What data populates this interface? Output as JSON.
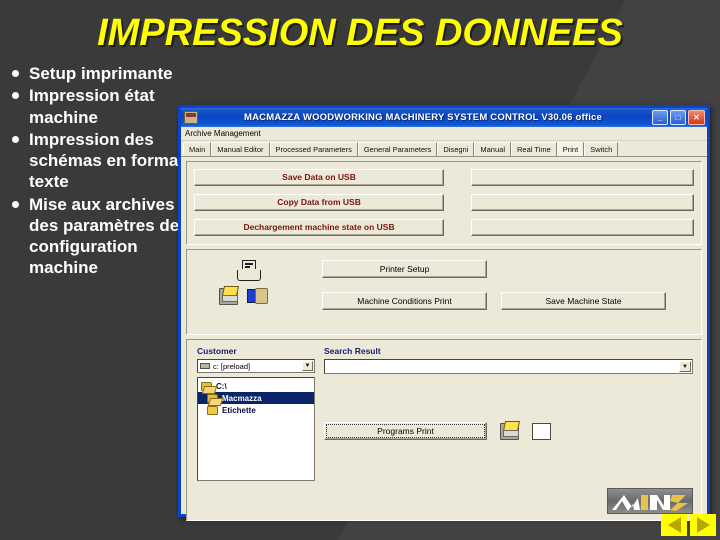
{
  "slide": {
    "title": "IMPRESSION DES DONNEES",
    "bullets": [
      "Setup imprimante",
      "Impression état machine",
      "Impression des schémas en format texte",
      "Mise aux archives des paramètres de configuration machine"
    ]
  },
  "app": {
    "title": "MACMAZZA WOODWORKING MACHINERY SYSTEM CONTROL  V30.06 office",
    "window_buttons": {
      "minimize": "_",
      "maximize": "□",
      "close": "✕"
    },
    "menubar": [
      "Archive Management"
    ],
    "tabs": [
      {
        "label": "Main",
        "active": false
      },
      {
        "label": "Manual Editor",
        "active": false
      },
      {
        "label": "Processed Parameters",
        "active": false
      },
      {
        "label": "General Parameters",
        "active": false
      },
      {
        "label": "Disegni",
        "active": false
      },
      {
        "label": "Manual",
        "active": false
      },
      {
        "label": "Real Time",
        "active": false
      },
      {
        "label": "Print",
        "active": true
      },
      {
        "label": "Switch",
        "active": false
      }
    ],
    "usb_panel": {
      "buttons": [
        "Save Data on USB",
        "Copy Data from USB",
        "Dechargement machine state on USB"
      ],
      "empty_buttons": [
        "",
        "",
        ""
      ]
    },
    "printer_panel": {
      "printer_setup": "Printer Setup",
      "machine_conditions_print": "Machine Conditions Print",
      "save_machine_state": "Save Machine State",
      "icons": [
        "printer-icon",
        "print-to-folder-icon",
        "machine-monitor-icon"
      ]
    },
    "customer_panel": {
      "customer_label": "Customer",
      "drive_value": "c: [preload]",
      "tree": [
        {
          "label": "C:\\",
          "selected": false,
          "indent": false,
          "state": "open"
        },
        {
          "label": "Macmazza",
          "selected": true,
          "indent": true,
          "state": "open"
        },
        {
          "label": "Etichette",
          "selected": false,
          "indent": true,
          "state": "closed"
        }
      ],
      "search_label": "Search Result",
      "search_value": "",
      "programs_print": "Programs Print",
      "icons": [
        "print-icon",
        "list-view-icon"
      ]
    }
  },
  "nav": {
    "prev": "previous-slide",
    "next": "next-slide"
  },
  "colors": {
    "slide_bg": "#3a3a3a",
    "title_yellow": "#ffff00",
    "usb_button_text": "#7a1512",
    "label_blue": "#1b1b70",
    "selection_blue": "#0a246a",
    "titlebar_blue": "#0a46c4"
  }
}
